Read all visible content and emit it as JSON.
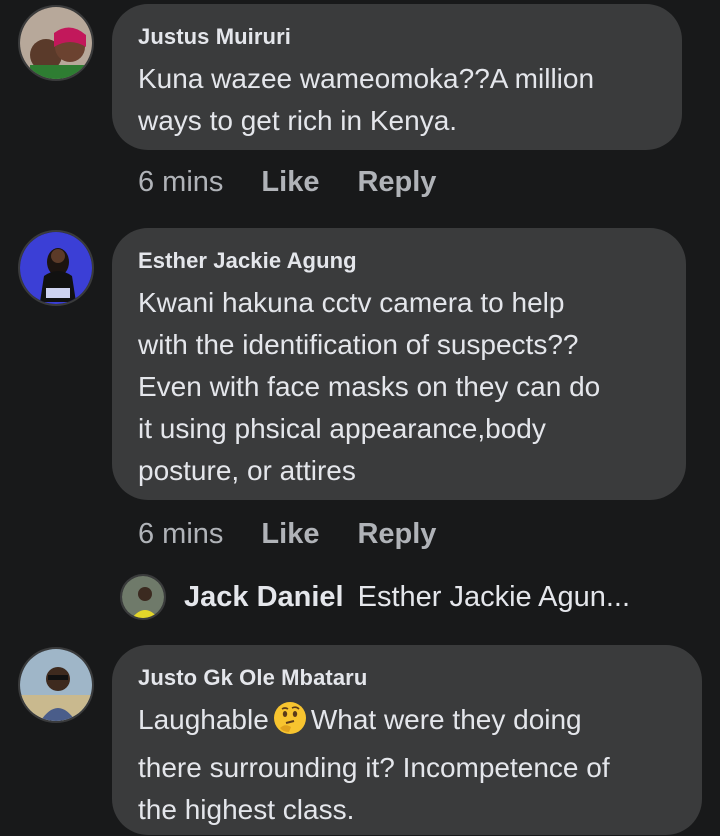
{
  "comments": [
    {
      "author": "Justus Muiruri",
      "text": "Kuna wazee wameomoka??A million\nways to get rich in Kenya.",
      "time": "6 mins",
      "like": "Like",
      "reply": "Reply"
    },
    {
      "author": "Esther Jackie Agung",
      "text": "Kwani hakuna cctv camera to help\nwith the identification of suspects??\nEven with face masks on they can do\nit using phsical appearance,body\nposture, or attires",
      "time": "6 mins",
      "like": "Like",
      "reply": "Reply"
    },
    {
      "author": "Justo Gk Ole Mbataru",
      "text_part1": "Laughable",
      "text_part2": "What were they doing",
      "text_rest": "there surrounding it? Incompetence of\nthe highest class."
    }
  ],
  "reply_preview": {
    "name": "Jack Daniel",
    "snippet": "Esther Jackie Agun..."
  },
  "colors": {
    "background": "#18191a",
    "bubble": "#3a3b3c",
    "text": "#e4e6eb",
    "secondary": "#b0b3b8"
  },
  "icons": [
    "avatar-justus",
    "avatar-esther",
    "avatar-jack",
    "avatar-justo",
    "thinking-face-emoji"
  ]
}
